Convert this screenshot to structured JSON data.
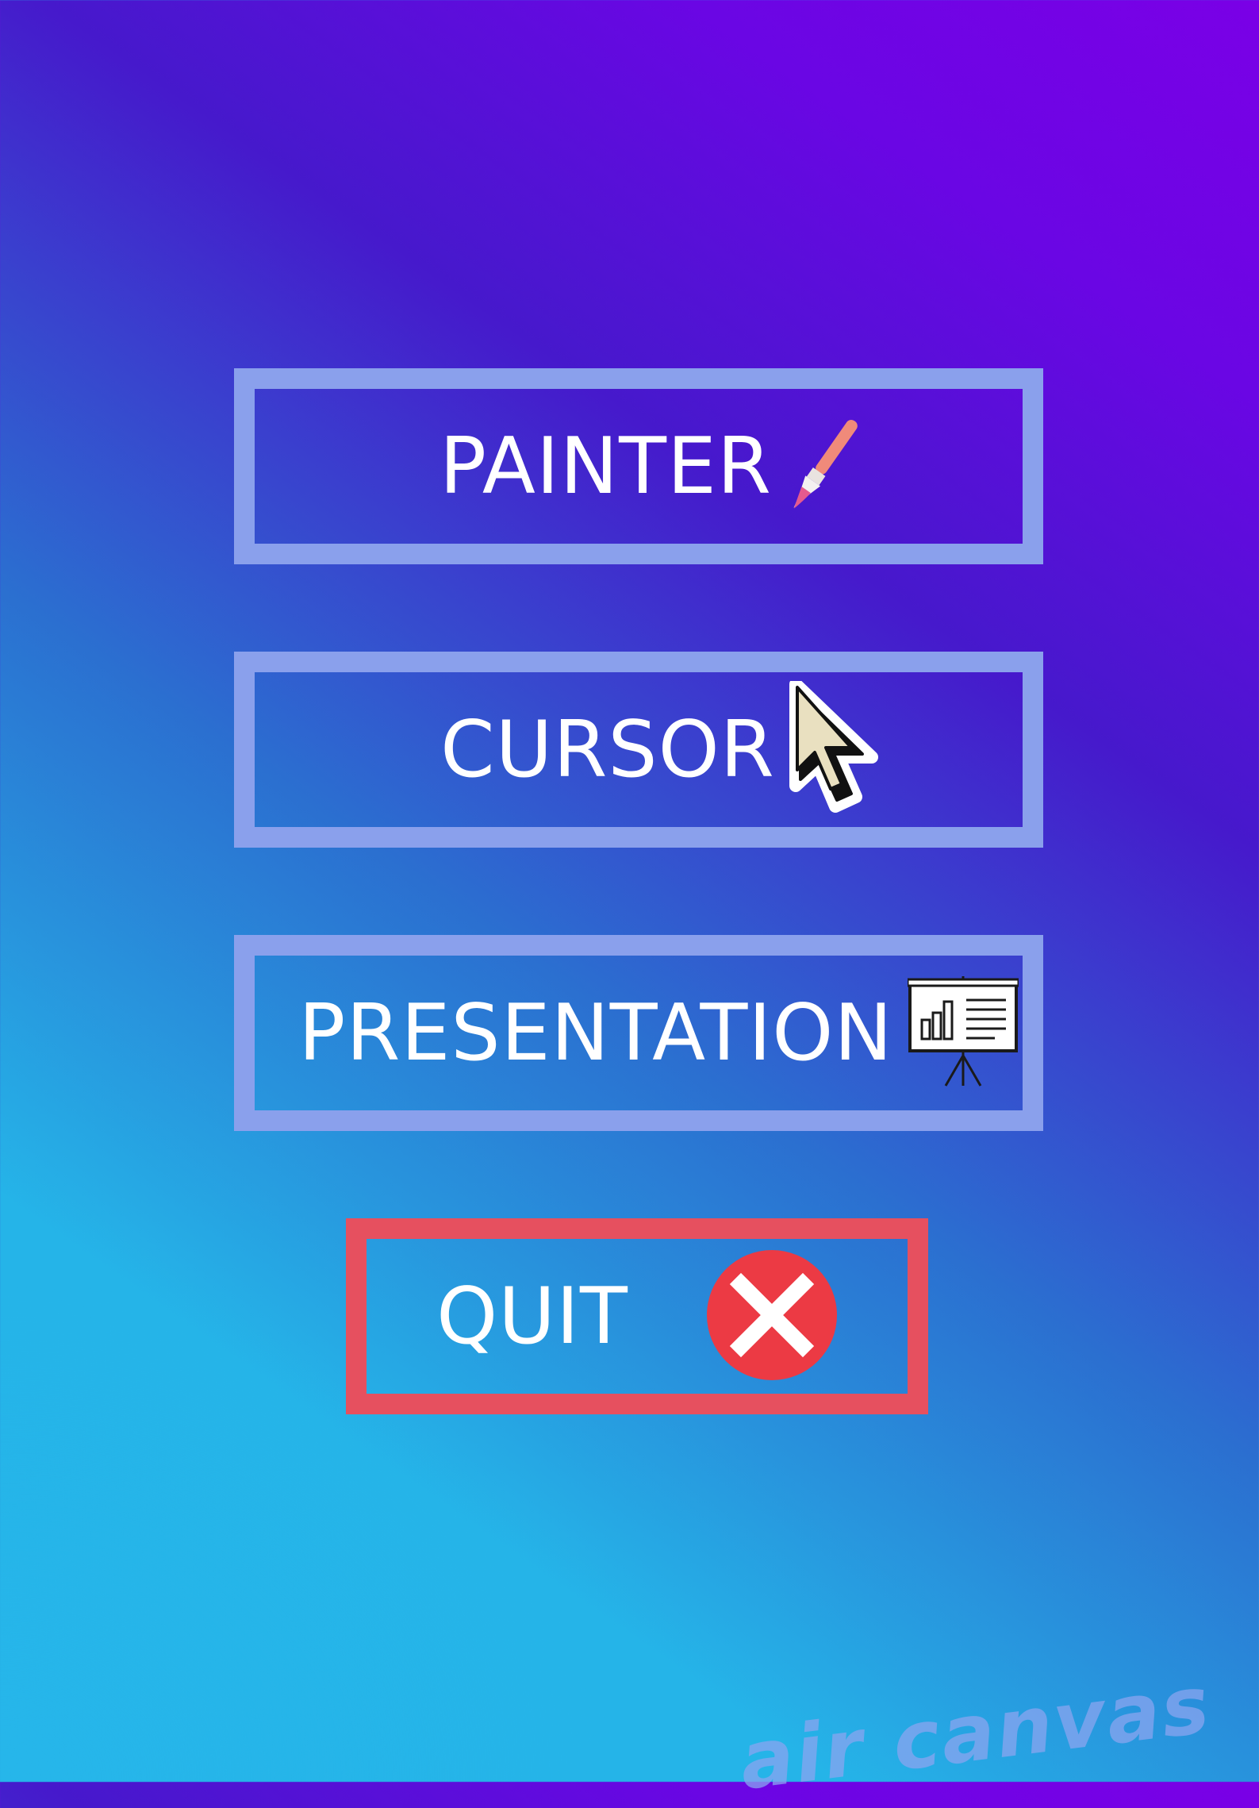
{
  "menu": {
    "painter": {
      "label": "PAINTER",
      "icon": "paintbrush-icon"
    },
    "cursor": {
      "label": "CURSOR",
      "icon": "mouse-pointer-icon"
    },
    "presentation": {
      "label": "PRESENTATION",
      "icon": "presentation-board-icon"
    },
    "quit": {
      "label": "QUIT",
      "icon": "close-icon"
    }
  },
  "watermark": {
    "text": "air canvas"
  },
  "colors": {
    "button_border": "#8aa0ec",
    "quit_border": "#e6505f",
    "quit_icon": "#ec3a44",
    "gradient_start": "#25b4e8",
    "gradient_end": "#7a00e6"
  }
}
